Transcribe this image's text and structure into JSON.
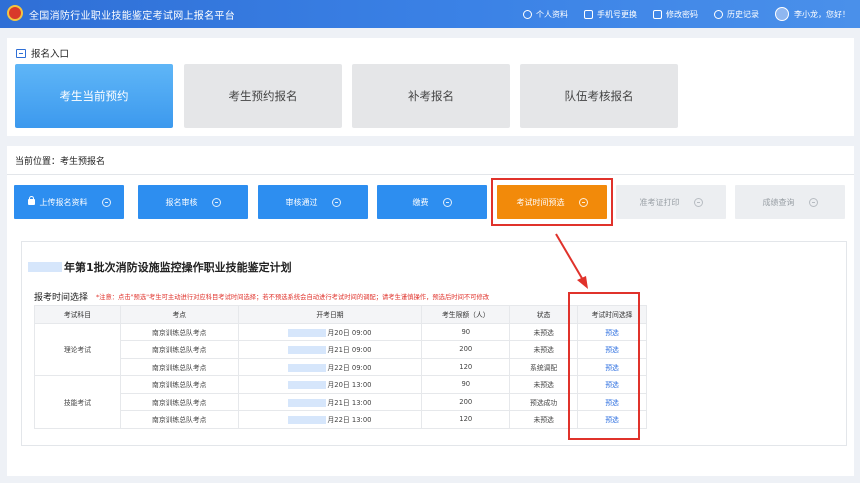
{
  "header": {
    "site_title": "全国消防行业职业技能鉴定考试网上报名平台",
    "nav": [
      {
        "label": "个人资料",
        "icon": "user-icon"
      },
      {
        "label": "手机号更换",
        "icon": "phone-icon"
      },
      {
        "label": "修改密码",
        "icon": "lock-icon"
      },
      {
        "label": "历史记录",
        "icon": "clock-icon"
      }
    ],
    "user_greeting": "李小龙，您好！",
    "accent": "#2f6fd6"
  },
  "entry_section": {
    "title": "报名入口",
    "entries": [
      {
        "label": "考生当前预约",
        "active": true
      },
      {
        "label": "考生预约报名",
        "active": false
      },
      {
        "label": "补考报名",
        "active": false
      },
      {
        "label": "队伍考核报名",
        "active": false
      }
    ]
  },
  "breadcrumb": "当前位置：考生预报名",
  "steps": [
    {
      "label": "上传报名资料",
      "state": "done",
      "color": "#2d8ef0"
    },
    {
      "label": "报名审核",
      "state": "done",
      "color": "#2d8ef0"
    },
    {
      "label": "审核通过",
      "state": "done",
      "color": "#2d8ef0"
    },
    {
      "label": "缴费",
      "state": "done",
      "color": "#2d8ef0"
    },
    {
      "label": "考试时间预选",
      "state": "current",
      "color": "#f28a0a"
    },
    {
      "label": "准考证打印",
      "state": "pending",
      "color": "#eceef1"
    },
    {
      "label": "成绩查询",
      "state": "pending",
      "color": "#eceef1"
    }
  ],
  "plan": {
    "title": "年第1批次消防设施监控操作职业技能鉴定计划",
    "time_selection_label": "报考时间选择",
    "notice": "*注意：点击\"预选\"考生可主动进行对应科目考试时间选择；若不预选系统会自动进行考试时间的调配；请考生谨慎操作，预选后时间不可修改",
    "columns": [
      "考试科目",
      "考点",
      "开考日期",
      "考生限额（人）",
      "状态",
      "考试时间选择"
    ],
    "groups": [
      {
        "subject": "理论考试",
        "rows": [
          {
            "site": "南京训练总队考点",
            "date": "月20日  09:00",
            "limit": "90",
            "status": "未预选",
            "action": "预选"
          },
          {
            "site": "南京训练总队考点",
            "date": "月21日  09:00",
            "limit": "200",
            "status": "未预选",
            "action": "预选"
          },
          {
            "site": "南京训练总队考点",
            "date": "月22日  09:00",
            "limit": "120",
            "status": "系统调配",
            "action": "预选"
          }
        ]
      },
      {
        "subject": "技能考试",
        "rows": [
          {
            "site": "南京训练总队考点",
            "date": "月20日  13:00",
            "limit": "90",
            "status": "未预选",
            "action": "预选"
          },
          {
            "site": "南京训练总队考点",
            "date": "月21日  13:00",
            "limit": "200",
            "status": "预选成功",
            "action": "预选"
          },
          {
            "site": "南京训练总队考点",
            "date": "月22日  13:00",
            "limit": "120",
            "status": "未预选",
            "action": "预选"
          }
        ]
      }
    ]
  }
}
